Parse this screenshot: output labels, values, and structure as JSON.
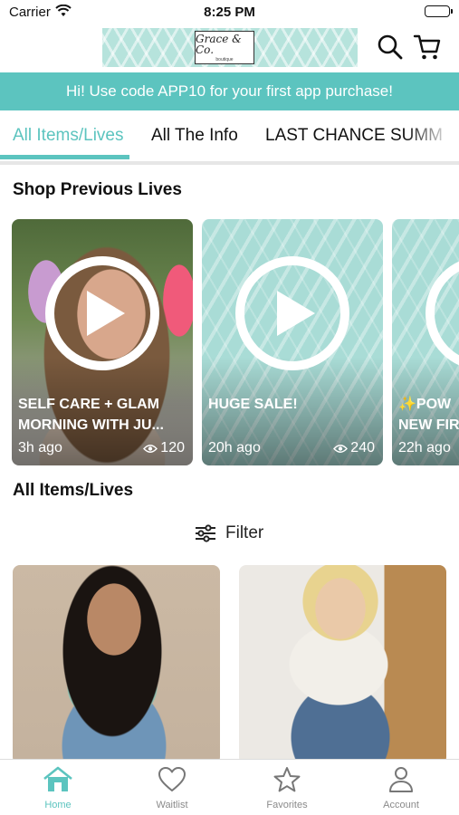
{
  "status_bar": {
    "carrier": "Carrier",
    "time": "8:25 PM"
  },
  "header": {
    "logo_text": "Grace & Co.",
    "logo_subtext": "boutique",
    "icons": [
      "search-icon",
      "cart-icon"
    ]
  },
  "promo": {
    "text": "Hi! Use code APP10 for your first app purchase!"
  },
  "tabs": [
    {
      "label": "All Items/Lives",
      "active": true
    },
    {
      "label": "All The Info",
      "active": false
    },
    {
      "label": "LAST CHANCE SUMM",
      "active": false
    }
  ],
  "shop_previous_lives": {
    "title": "Shop Previous Lives",
    "cards": [
      {
        "title_line1": "SELF CARE + GLAM",
        "title_line2": "MORNING WITH JU...",
        "ago": "3h ago",
        "views": "120"
      },
      {
        "title_line1": "HUGE SALE!",
        "title_line2": "",
        "ago": "20h ago",
        "views": "240"
      },
      {
        "title_line1": "✨POW",
        "title_line2": "NEW FIR",
        "ago": "22h ago",
        "views": ""
      }
    ]
  },
  "all_items": {
    "title": "All Items/Lives",
    "filter_label": "Filter"
  },
  "bottom_nav": [
    {
      "label": "Home",
      "icon": "home-icon",
      "active": true
    },
    {
      "label": "Waitlist",
      "icon": "heart-icon",
      "active": false
    },
    {
      "label": "Favorites",
      "icon": "star-icon",
      "active": false
    },
    {
      "label": "Account",
      "icon": "account-icon",
      "active": false
    }
  ],
  "colors": {
    "accent": "#5cc4bf",
    "pattern": "#b6e3dc",
    "inactive_nav": "#8a8a8a"
  }
}
